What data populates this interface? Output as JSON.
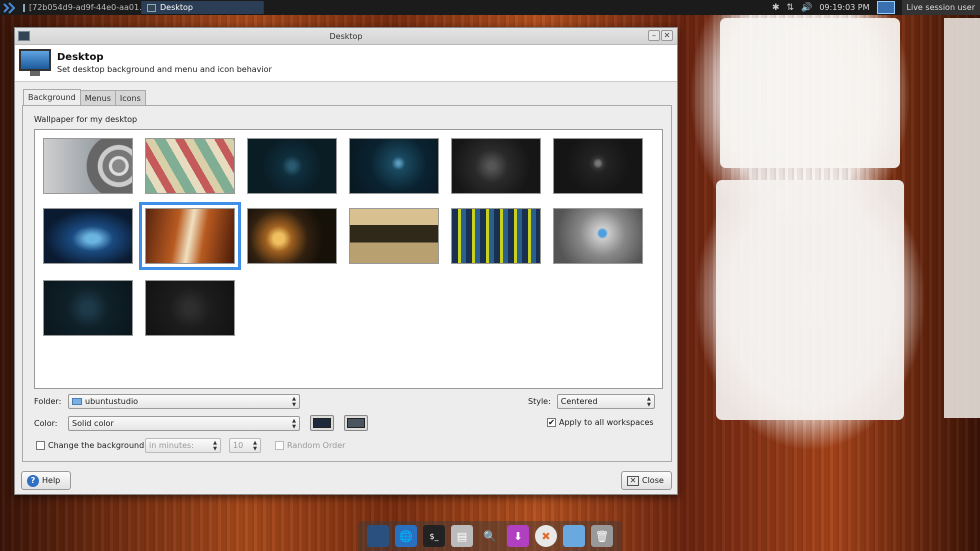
{
  "top_panel": {
    "tasks": [
      {
        "label": "[72b054d9-ad9f-44e0-aa01..."
      },
      {
        "label": "Desktop"
      }
    ],
    "clock": "09:19:03 PM",
    "indicators": [
      "✱",
      "⇅",
      "🔊"
    ],
    "user": "Live session user"
  },
  "window": {
    "title": "Desktop",
    "header_title": "Desktop",
    "header_subtitle": "Set desktop background and menu and icon behavior",
    "tabs": [
      {
        "label": "Background",
        "active": true
      },
      {
        "label": "Menus",
        "active": false
      },
      {
        "label": "Icons",
        "active": false
      }
    ],
    "section_label": "Wallpaper for my desktop",
    "wallpapers": [
      {
        "style": "radial-gradient(circle at 85% 50%, #888 0 8%, #ddd 9% 12%, #777 13% 20%, #ccc 21% 26%, #666 27% 40%, transparent 41%), linear-gradient(90deg, #cfcfcf, #9aa0a6 60%, #5a6066)",
        "selected": false
      },
      {
        "style": "repeating-linear-gradient(60deg, #7fae94 0 10px, #e8dcc0 10px 18px, #c45a5a 18px 26px, #d9cfa8 26px 34px)",
        "selected": false
      },
      {
        "style": "radial-gradient(circle at 50% 50%, #2a5a70 0 6%, #0f2e3c 20%, #0a1c24 60%)",
        "selected": false
      },
      {
        "style": "radial-gradient(circle at 55% 45%, #5a9ac0 0 3%, #1a4a60 12%, #0a2230 50%, #081820)",
        "selected": false
      },
      {
        "style": "radial-gradient(circle at 45% 50%, #555 0 6%, #2a2a2a 30%, #161616 70%)",
        "selected": false
      },
      {
        "style": "radial-gradient(circle at 50% 45%, #777 0 4%, #333 10%, #222 18%, #151515 60%)",
        "selected": false
      },
      {
        "style": "radial-gradient(ellipse at 55% 55%, #6ab4e0 0 10%, #1a4a80 30%, #0a1a30 70%), linear-gradient(#0a1a30, #184070)",
        "selected": false
      },
      {
        "style": "linear-gradient(100deg, #5a2510 0%, #b85a20 35%, #f0e0c0 50%, #b85a20 65%, #4a1a08 100%)",
        "selected": true
      },
      {
        "style": "radial-gradient(circle at 35% 55%, #f0c060 0 8%, #a06020 20%, #302010 45%, #151008 70%)",
        "selected": false
      },
      {
        "style": "linear-gradient(#d8c090 0 30%, #302818 30% 62%, #b8a070 62%)",
        "selected": false
      },
      {
        "style": "repeating-linear-gradient(90deg, #1a3050 0 6px, #c8d020 6px 9px, #2a6090 9px 14px), linear-gradient(#0a1a30, #306080)",
        "selected": false
      },
      {
        "style": "radial-gradient(circle at 55% 45%, #4aa0e0 0 6%, #ccc 10%, #888 40%, #555 80%)",
        "selected": false
      },
      {
        "style": "radial-gradient(circle at 50% 50%, #1e3a4a 0 10%, #0f2028 40%, #0a161c)",
        "selected": false
      },
      {
        "style": "radial-gradient(circle at 50% 50%, #2e2e2e 0 10%, #1c1c1c 40%, #121212)",
        "selected": false
      }
    ],
    "folder_label": "Folder:",
    "folder_value": "ubuntustudio",
    "style_label": "Style:",
    "style_value": "Centered",
    "color_label": "Color:",
    "color_value": "Solid color",
    "color1": "#1c2b3a",
    "color2": "#4a5560",
    "apply_all_label": "Apply to all workspaces",
    "apply_all_checked": true,
    "change_bg_label": "Change the background",
    "change_bg_checked": false,
    "interval_unit_value": "in minutes:",
    "interval_value": "10",
    "random_order_label": "Random Order",
    "help_label": "Help",
    "close_label": "Close"
  },
  "dock": {
    "items": [
      {
        "icon": "desktop-icon"
      },
      {
        "icon": "globe-icon"
      },
      {
        "icon": "terminal-icon"
      },
      {
        "icon": "settings-manager-icon"
      },
      {
        "icon": "magnifier-icon"
      },
      {
        "icon": "download-icon"
      },
      {
        "icon": "disc-icon"
      },
      {
        "icon": "folder-icon"
      },
      {
        "icon": "trash-icon"
      }
    ]
  }
}
